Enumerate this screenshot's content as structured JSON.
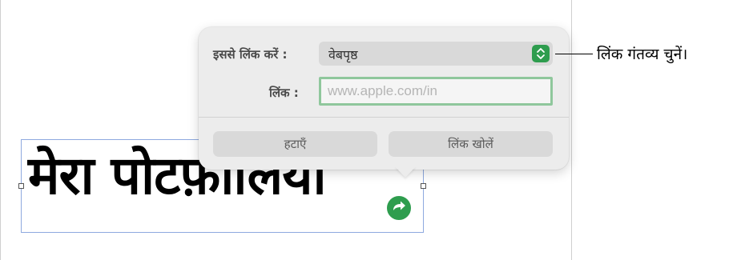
{
  "document": {
    "headline": "मेरा पोटफ़ॉलियो"
  },
  "popover": {
    "link_to_label": "इससे लिंक करें :",
    "link_to_value": "वेबपृष्ठ",
    "link_label": "लिंक :",
    "link_placeholder": "www.apple.com/in",
    "link_value": "",
    "remove_button": "हटाएँ",
    "open_link_button": "लिंक खोलें"
  },
  "callout": {
    "text": "लिंक गंतव्य चुनें।"
  },
  "colors": {
    "accent_green": "#2e9d4e",
    "input_focus_ring": "#8fc79c",
    "selection_border": "#8ea9df"
  },
  "icons": {
    "stepper": "chevron-up-down-icon",
    "link_badge": "curved-arrow-right-icon"
  }
}
